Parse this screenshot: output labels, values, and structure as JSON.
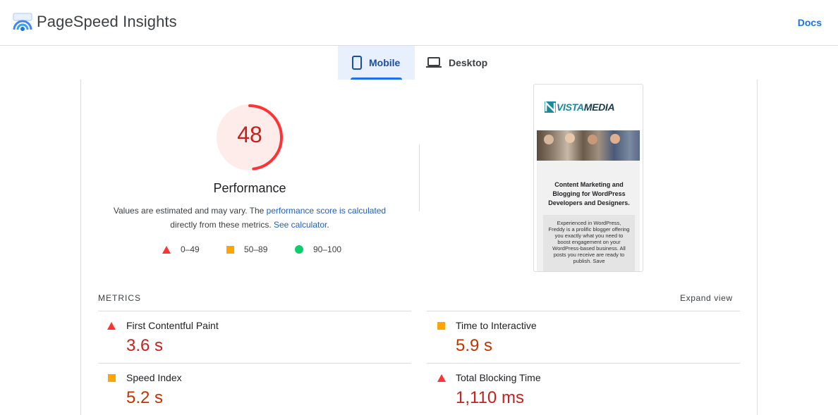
{
  "app": {
    "title": "PageSpeed Insights",
    "docs_label": "Docs"
  },
  "tabs": [
    {
      "label": "Mobile",
      "icon": "smartphone-icon",
      "selected": true
    },
    {
      "label": "Desktop",
      "icon": "laptop-icon",
      "selected": false
    }
  ],
  "performance": {
    "score": "48",
    "score_fraction": 0.48,
    "title": "Performance",
    "desc_prefix": "Values are estimated and may vary. The ",
    "desc_link1": "performance score is calculated",
    "desc_mid": "directly from these metrics. ",
    "desc_link2": "See calculator",
    "desc_suffix": "."
  },
  "legend": [
    {
      "range": "0–49",
      "shape": "triangle",
      "color": "#ff3333"
    },
    {
      "range": "50–89",
      "shape": "square",
      "color": "#ffa400"
    },
    {
      "range": "90–100",
      "shape": "circle",
      "color": "#0cce6b"
    }
  ],
  "screenshot": {
    "brand_main": "VISTA",
    "brand_accent": "MEDIA",
    "heading": "Content Marketing and Blogging for WordPress Developers and Designers.",
    "body": "Experienced in WordPress, Freddy is a prolific blogger offering you exactly what you need to boost engagement on your WordPress-based business. All posts you receive are ready to publish. Save"
  },
  "metrics": {
    "label": "METRICS",
    "expand_label": "Expand view",
    "items": [
      {
        "name": "First Contentful Paint",
        "value": "3.6 s",
        "rating": "fail"
      },
      {
        "name": "Time to Interactive",
        "value": "5.9 s",
        "rating": "average"
      },
      {
        "name": "Speed Index",
        "value": "5.2 s",
        "rating": "average"
      },
      {
        "name": "Total Blocking Time",
        "value": "1,110 ms",
        "rating": "fail"
      }
    ]
  },
  "colors": {
    "accent": "#1a73e8",
    "fail": "#ff3333",
    "average": "#ffa400",
    "pass": "#0cce6b",
    "fail_text": "#c5221f"
  }
}
